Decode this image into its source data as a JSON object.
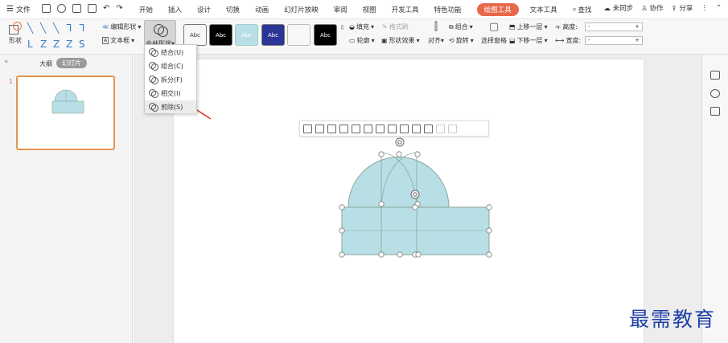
{
  "menubar": {
    "file_label": "文件",
    "tabs": [
      "开始",
      "插入",
      "设计",
      "切换",
      "动画",
      "幻灯片放映",
      "审阅",
      "视图",
      "开发工具",
      "特色功能",
      "绘图工具",
      "文本工具"
    ],
    "active_tab": "绘图工具",
    "search_label": "查找",
    "unsync_label": "未同步",
    "collab_label": "协作",
    "share_label": "分享"
  },
  "ribbon": {
    "shape_label": "形状",
    "edit_shape_label": "编辑形状",
    "textbox_label": "文本框",
    "merge_shape_label": "合并形状",
    "style_boxes": [
      {
        "text": "Abc",
        "bg": "#ffffff",
        "fg": "#333333"
      },
      {
        "text": "Abc",
        "bg": "#000000",
        "fg": "#ffffff"
      },
      {
        "text": "Abc",
        "bg": "#b8dfe6",
        "fg": "#ffffff"
      },
      {
        "text": "Abc",
        "bg": "#2b3596",
        "fg": "#ffffff"
      },
      {
        "text": "",
        "bg": "#ffffff",
        "fg": "#333333"
      },
      {
        "text": "Abc",
        "bg": "#000000",
        "fg": "#ffffff"
      }
    ],
    "fill_label": "填充",
    "format_painter_label": "格式刷",
    "outline_label": "轮廓",
    "shape_effect_label": "形状效果",
    "align_label": "对齐",
    "group_label": "组合",
    "rotate_label": "旋转",
    "selection_pane_label": "选择窗格",
    "bring_forward_label": "上移一层",
    "send_backward_label": "下移一层",
    "height_label": "高度:",
    "width_label": "宽度:",
    "height_value": "-",
    "width_value": "-"
  },
  "merge_menu": {
    "items": [
      {
        "label": "结合(U)"
      },
      {
        "label": "组合(C)"
      },
      {
        "label": "拆分(F)"
      },
      {
        "label": "相交(I)"
      },
      {
        "label": "剪除(S)"
      }
    ],
    "highlighted": "剪除(S)"
  },
  "left_panel": {
    "tab_outline": "大纲",
    "tab_slides": "幻灯片",
    "slide_number": "1"
  },
  "watermark": "最需教育",
  "colors": {
    "shape_fill": "#b8dfe6",
    "shape_stroke": "#8aa69a",
    "active_tab": "#e8684a",
    "thumb_border": "#e69550",
    "arrow": "#e03a2e"
  }
}
